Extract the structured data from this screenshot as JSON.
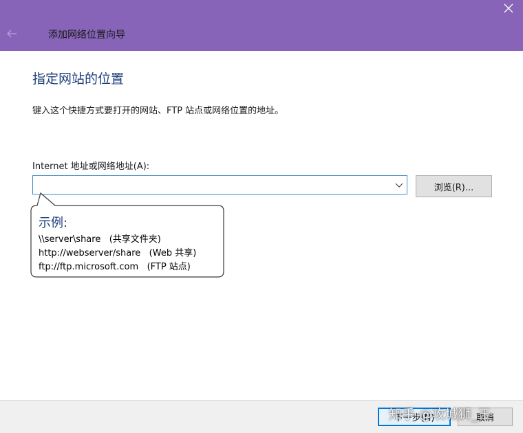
{
  "window": {
    "title": "添加网络位置向导",
    "accent_color": "#8764b8"
  },
  "icons": {
    "back": "back-arrow-icon",
    "close": "close-icon",
    "dropdown": "chevron-down-icon"
  },
  "main": {
    "heading": "指定网站的位置",
    "instruction": "键入这个快捷方式要打开的网站、FTP 站点或网络位置的地址。",
    "address_label": "Internet 地址或网络地址(A):",
    "address_value": "",
    "browse_label": "浏览(R)..."
  },
  "tooltip": {
    "heading": "示例:",
    "examples": [
      "\\\\server\\share   (共享文件夹)",
      "http://webserver/share   (Web 共享)",
      "ftp://ftp.microsoft.com   (FTP 站点)"
    ]
  },
  "footer": {
    "next_label": "下一步(N)",
    "cancel_label": "取消"
  },
  "watermark": "知乎 @攻城狮_王"
}
